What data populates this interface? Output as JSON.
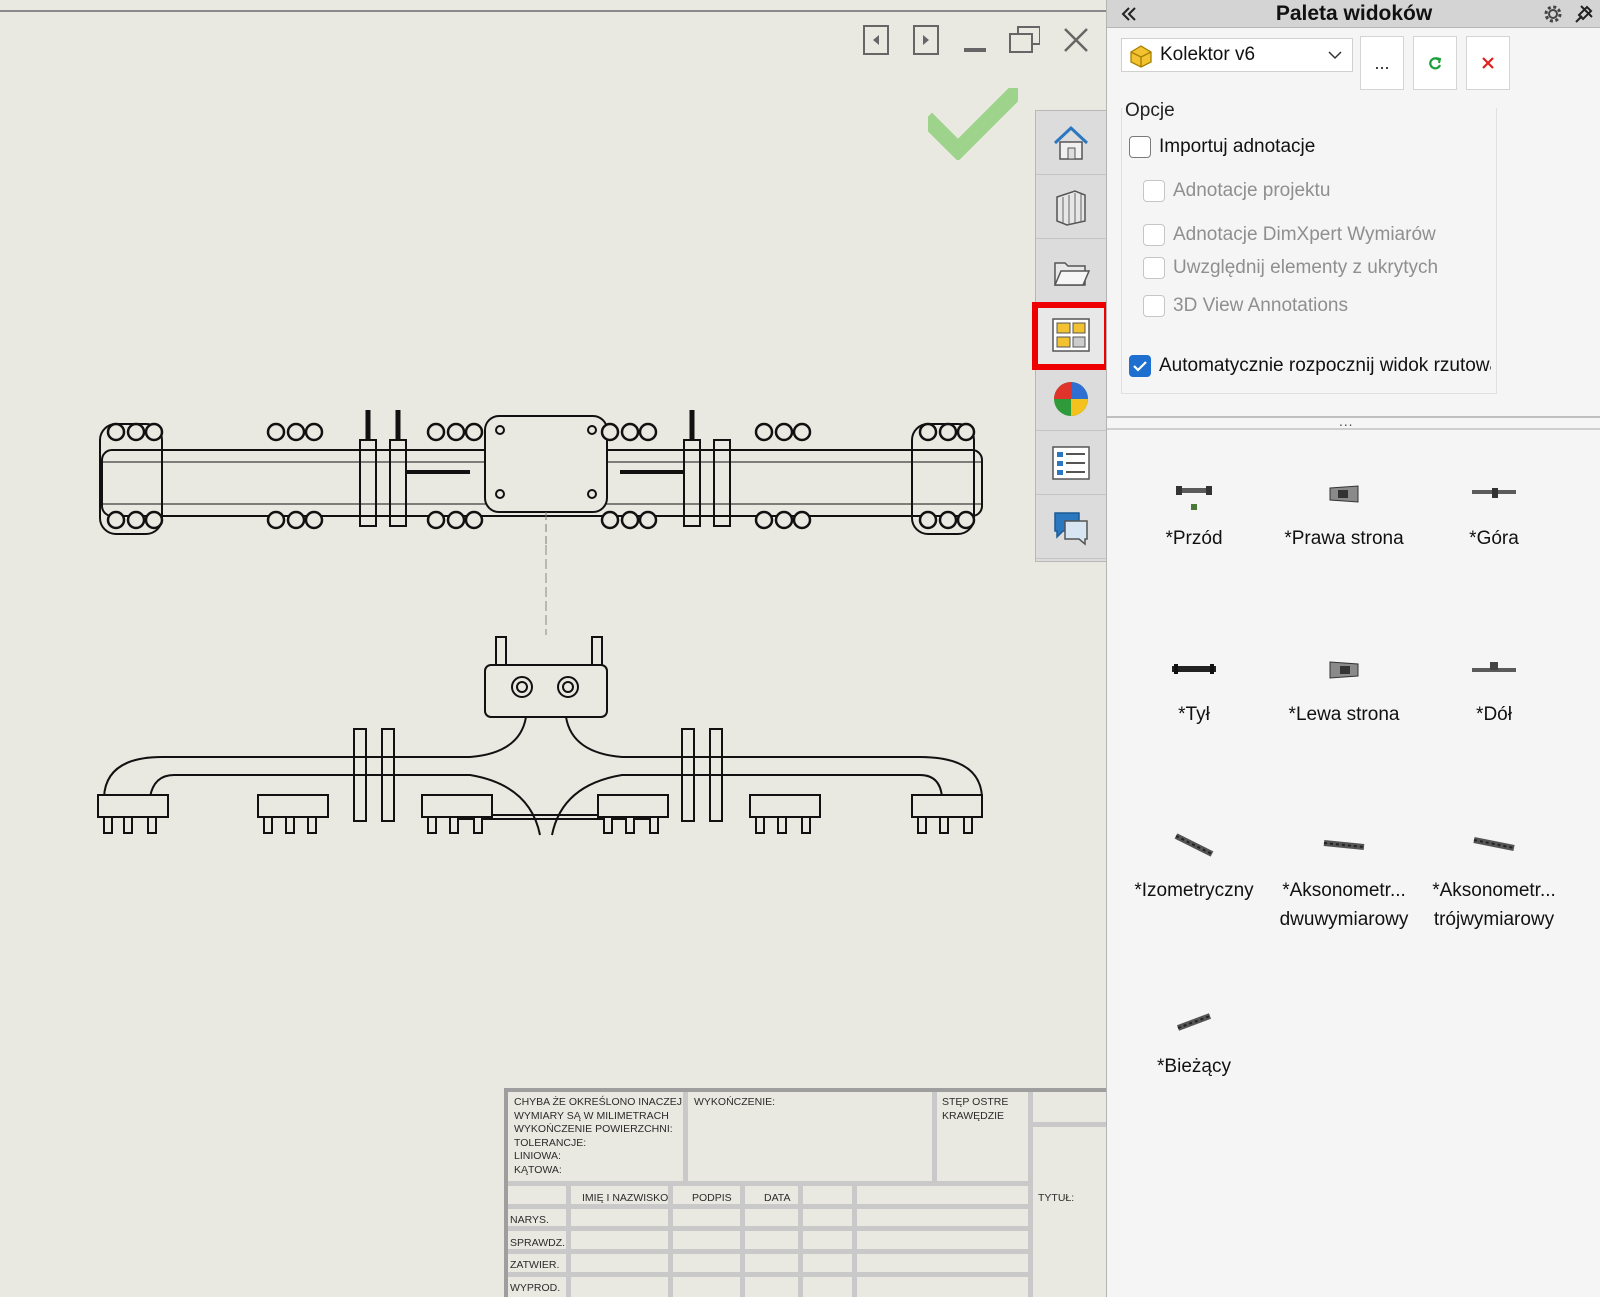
{
  "panel": {
    "title": "Paleta widoków",
    "model": "Kolektor v6",
    "browse_label": "...",
    "options_title": "Opcje",
    "options": [
      {
        "label": "Importuj adnotacje",
        "checked": false,
        "enabled": true
      },
      {
        "label": "Adnotacje projektu",
        "checked": false,
        "enabled": false
      },
      {
        "label": "Adnotacje DimXpert Wymiarów",
        "checked": false,
        "enabled": false
      },
      {
        "label": "Uwzględnij elementy z ukrytych",
        "checked": false,
        "enabled": false
      },
      {
        "label": "3D View Annotations",
        "checked": false,
        "enabled": false
      },
      {
        "label": "Automatycznie rozpocznij widok rzutowa",
        "checked": true,
        "enabled": true
      }
    ],
    "splitter_grip": "...",
    "views": [
      {
        "label": "*Przód"
      },
      {
        "label": "*Prawa strona"
      },
      {
        "label": "*Góra"
      },
      {
        "label": "*Tył"
      },
      {
        "label": "*Lewa strona"
      },
      {
        "label": "*Dół"
      },
      {
        "label": "*Izometryczny"
      },
      {
        "label": "*Aksonometr...\ndwuwymiarowy"
      },
      {
        "label": "*Aksonometr...\ntrójwymiarowy"
      },
      {
        "label": "*Bieżący"
      }
    ]
  },
  "tabs": [
    {
      "icon": "home-icon"
    },
    {
      "icon": "design-library-icon"
    },
    {
      "icon": "file-explorer-icon"
    },
    {
      "icon": "view-palette-icon",
      "active": true
    },
    {
      "icon": "appearances-icon"
    },
    {
      "icon": "custom-properties-icon"
    },
    {
      "icon": "forum-icon"
    }
  ],
  "title_block": {
    "notes": "CHYBA ŻE OKREŚLONO INACZEJ:\nWYMIARY SĄ W MILIMETRACH\nWYKOŃCZENIE POWIERZCHNI:\nTOLERANCJE:\n   LINIOWA:\n   KĄTOWA:",
    "finish": "WYKOŃCZENIE:",
    "edges": "STĘP OSTRE\nKRAWĘDZIE",
    "col_name": "IMIĘ I NAZWISKO",
    "col_sign": "PODPIS",
    "col_date": "DATA",
    "title_label": "TYTUŁ:",
    "rows": [
      "NARYS.",
      "SPRAWDZ.",
      "ZATWIER.",
      "WYPROD."
    ]
  },
  "colors": {
    "accent": "#1f6fd0",
    "highlight": "#ef0000",
    "confirm": "#8fcf7a",
    "canvas": "#e9e9e1"
  }
}
